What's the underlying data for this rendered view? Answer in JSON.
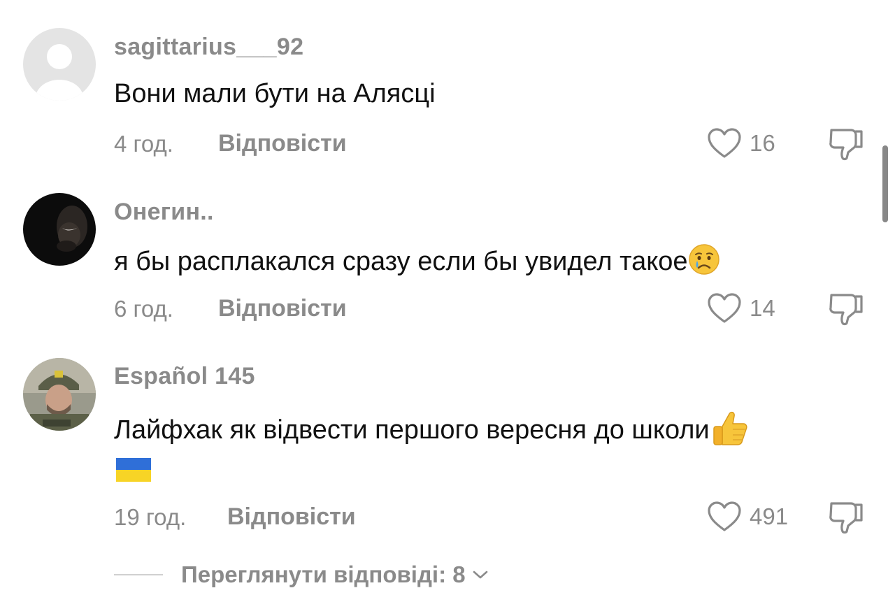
{
  "comments": [
    {
      "username": "sagittarius___92",
      "text": "Вони мали бути на Алясці",
      "time": "4 год.",
      "reply_label": "Відповісти",
      "likes": "16",
      "avatar": "default-avatar-icon"
    },
    {
      "username": "Онегин..",
      "text": "я бы расплакался сразу если бы увидел такое",
      "emoji": "crying-face-icon",
      "time": "6 год.",
      "reply_label": "Відповісти",
      "likes": "14",
      "avatar": "dark-portrait"
    },
    {
      "username": "Español 145",
      "text": "Лайфхак як відвести першого вересня до школи",
      "emoji": "thumbs-up-icon",
      "emoji_line2": "ukraine-flag-icon",
      "time": "19 год.",
      "reply_label": "Відповісти",
      "likes": "491",
      "avatar": "soldier-portrait"
    }
  ],
  "view_replies": {
    "label": "Переглянути відповіді: 8"
  },
  "colors": {
    "secondary_text": "#8a8a8a",
    "primary_text": "#111111"
  }
}
